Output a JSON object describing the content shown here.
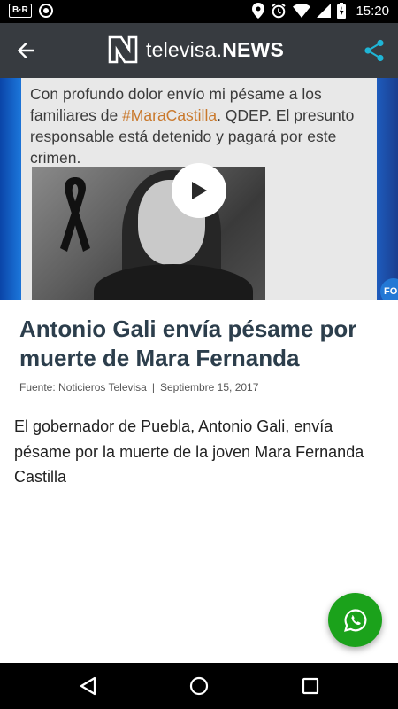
{
  "status_bar": {
    "left_badge": "B·R",
    "time": "15:20",
    "icons": [
      "br-icon",
      "circle-notification-icon",
      "location-icon",
      "alarm-icon",
      "wifi-icon",
      "signal-icon",
      "battery-charging-icon"
    ]
  },
  "app_bar": {
    "brand_prefix": "televisa.",
    "brand_suffix": "NEWS",
    "back_icon": "arrow-back-icon",
    "share_icon": "share-icon",
    "colors": {
      "background": "#373b40",
      "share": "#1fb5d6"
    }
  },
  "video": {
    "tweet_text_before": "Con profundo dolor envío mi pésame a los familiares de ",
    "tweet_hashtag": "#MaraCastilla",
    "tweet_text_after": ". QDEP. El presunto responsable está detenido y pagará por este crimen.",
    "corner_badge": "FO",
    "play_icon": "play-icon",
    "colors": {
      "hashtag": "#c9782b"
    }
  },
  "article": {
    "title": "Antonio Gali envía pésame por muerte de Mara Fernanda",
    "source": "Fuente: Noticieros Televisa",
    "separator": "|",
    "date": "Septiembre 15, 2017",
    "body": "El gobernador de Puebla, Antonio Gali, envía pésame por la muerte de la joven Mara Fernanda Castilla"
  },
  "fab": {
    "icon": "whatsapp-icon",
    "color": "#1ba21b"
  },
  "nav_bar": {
    "icons": [
      "nav-back-icon",
      "nav-home-icon",
      "nav-recents-icon"
    ]
  }
}
